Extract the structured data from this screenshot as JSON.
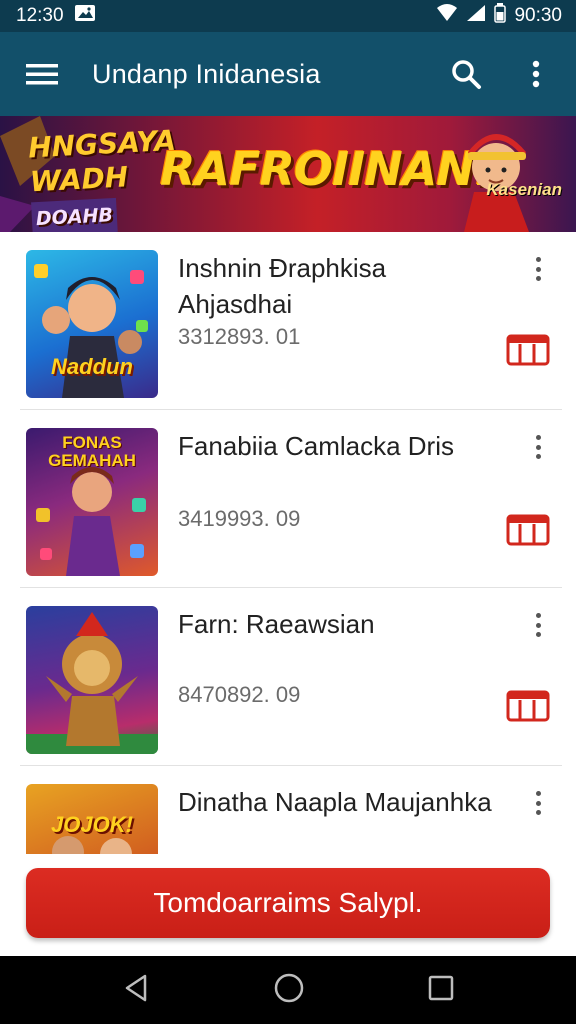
{
  "status_bar": {
    "time": "12:30",
    "battery_time": "90:30",
    "icons": [
      "image-icon",
      "wifi-icon",
      "signal-icon",
      "battery-icon"
    ]
  },
  "app_bar": {
    "title": "Undanp Inidanesia",
    "icons": [
      "menu-icon",
      "search-icon",
      "more-vert-icon"
    ]
  },
  "banner": {
    "left_line1": "HNGSAYA",
    "left_line2": "WADH",
    "left_small": "DOAHB",
    "main_text": "RAFROIINAN!",
    "side_text": "Kasenian"
  },
  "list": {
    "items": [
      {
        "title": "Inshnin Đraphkisa Ahjasdhai",
        "number": "3312893. 01",
        "thumb_label": "Naddun",
        "thumb_colors": [
          "#1b6fd1",
          "#2db8e6"
        ]
      },
      {
        "title": "Fanabiia Camlacka Dris",
        "number": "3419993. 09",
        "thumb_label": "FONAS GEMAHAH",
        "thumb_colors": [
          "#3a1a6e",
          "#e05a2a"
        ]
      },
      {
        "title": "Farn: Raeawsian",
        "number": "8470892. 09",
        "thumb_label": "",
        "thumb_colors": [
          "#2a3f9e",
          "#b82d6b"
        ]
      },
      {
        "title": "Dinatha Naapla Maujanhka",
        "number": "",
        "thumb_label": "JOJOK!",
        "thumb_colors": [
          "#e8a322",
          "#c2301f"
        ]
      }
    ]
  },
  "cta": {
    "label": "Tomdoarraims Salypl."
  },
  "colors": {
    "app_bar": "#12506a",
    "status_bar": "#0d3b4f",
    "accent_red": "#d2271d"
  }
}
